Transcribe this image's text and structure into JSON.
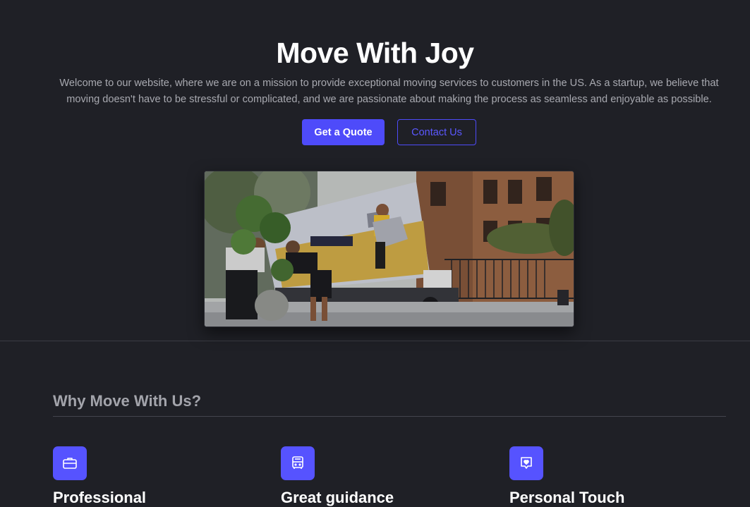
{
  "hero": {
    "title": "Move With Joy",
    "description": "Welcome to our website, where we are on a mission to provide exceptional moving services to customers in the US. As a startup, we believe that moving doesn't have to be stressful or complicated, and we are passionate about making the process as seamless and enjoyable as possible.",
    "primary_button": "Get a Quote",
    "secondary_button": "Contact Us",
    "image_alt": "Movers loading a moving truck in front of a brownstone building"
  },
  "why": {
    "title": "Why Move With Us?",
    "features": [
      {
        "title": "Professional",
        "icon": "briefcase-icon"
      },
      {
        "title": "Great guidance",
        "icon": "bus-icon"
      },
      {
        "title": "Personal Touch",
        "icon": "heart-chat-icon"
      }
    ]
  },
  "colors": {
    "background": "#1f2026",
    "accent": "#4e4bfa",
    "text_primary": "#ffffff",
    "text_muted": "#a8a9b0"
  }
}
